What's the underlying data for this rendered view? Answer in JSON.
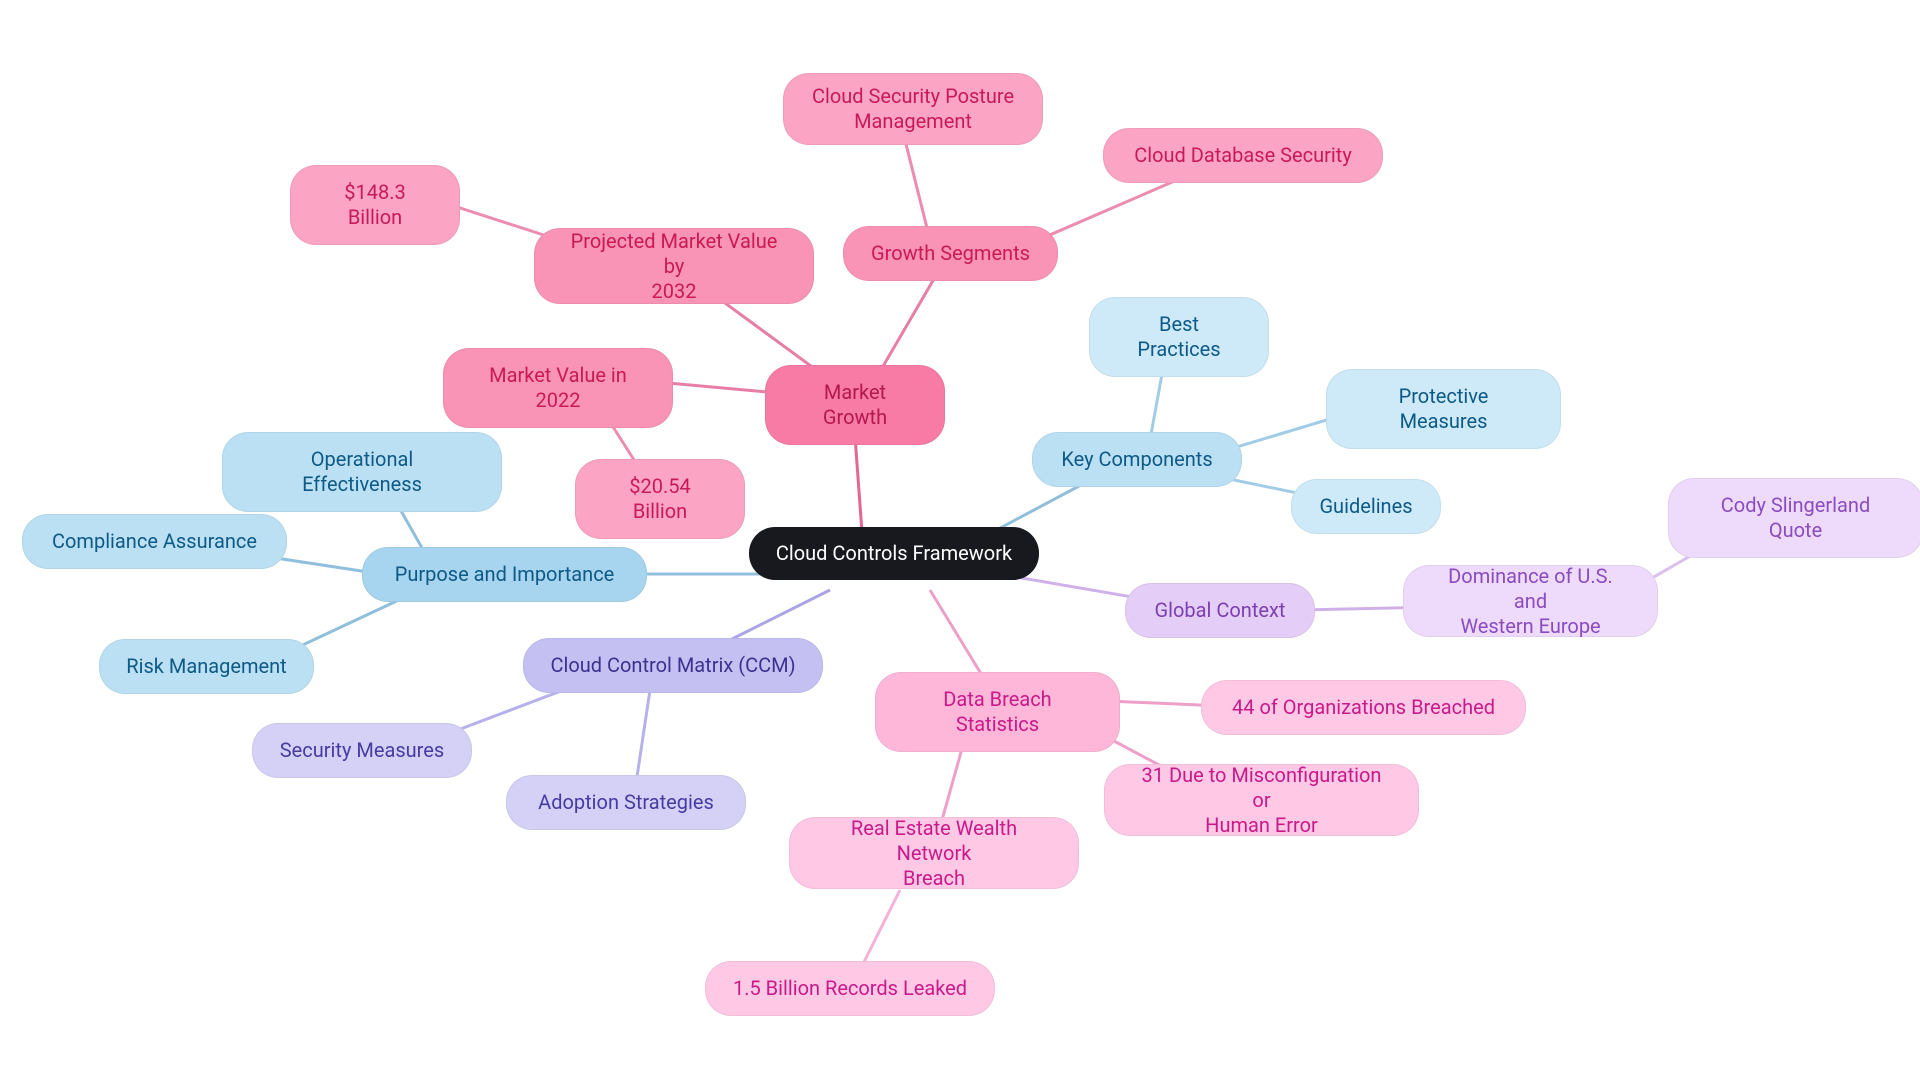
{
  "center": "Cloud Controls Framework",
  "marketGrowth": {
    "label": "Market Growth",
    "value2022Label": "Market Value in 2022",
    "value2022": "$20.54 Billion",
    "projectedLabel": "Projected Market Value by\n2032",
    "projectedValue": "$148.3 Billion",
    "growthSegmentsLabel": "Growth Segments",
    "cspm": "Cloud Security Posture\nManagement",
    "cdb": "Cloud Database Security"
  },
  "keyComponents": {
    "label": "Key Components",
    "bestPractices": "Best Practices",
    "protective": "Protective Measures",
    "guidelines": "Guidelines"
  },
  "globalContext": {
    "label": "Global Context",
    "dominance": "Dominance of U.S. and\nWestern Europe",
    "quote": "Cody Slingerland Quote"
  },
  "dataBreach": {
    "label": "Data Breach Statistics",
    "orgs": "44 of Organizations Breached",
    "misconfig": "31 Due to Misconfiguration or\nHuman Error",
    "realEstate": "Real Estate Wealth Network\nBreach",
    "records": "1.5 Billion Records Leaked"
  },
  "ccm": {
    "label": "Cloud Control Matrix (CCM)",
    "security": "Security Measures",
    "adoption": "Adoption Strategies"
  },
  "purpose": {
    "label": "Purpose and Importance",
    "opEff": "Operational Effectiveness",
    "compliance": "Compliance Assurance",
    "risk": "Risk Management"
  }
}
